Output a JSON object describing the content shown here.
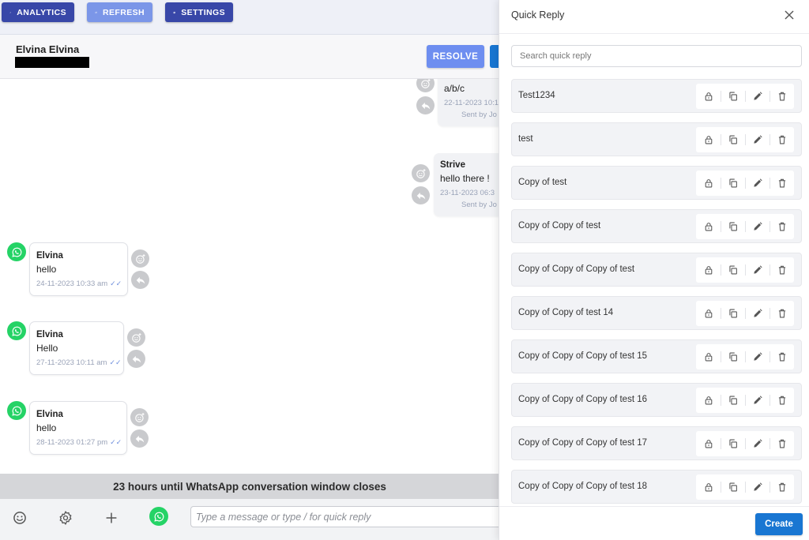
{
  "toolbar": {
    "analytics_label": "ANALYTICS",
    "refresh_label": "REFRESH",
    "settings_label": "SETTINGS"
  },
  "chat_header": {
    "contact_name": "Elvina Elvina",
    "resolve_label": "RESOLVE"
  },
  "messages": [
    {
      "direction": "out",
      "sender": "",
      "text": "a/b/c",
      "time": "22-11-2023 10:1",
      "sent_by": "Sent by Jo"
    },
    {
      "direction": "out",
      "sender": "Strive",
      "text": "hello there !",
      "time": "23-11-2023 06:3",
      "sent_by": "Sent by Jo"
    },
    {
      "direction": "in",
      "sender": "Elvina",
      "text": "hello",
      "time": "24-11-2023 10:33 am"
    },
    {
      "direction": "in",
      "sender": "Elvina",
      "text": "Hello",
      "time": "27-11-2023 10:11 am"
    },
    {
      "direction": "in",
      "sender": "Elvina",
      "text": "hello",
      "time": "28-11-2023 01:27 pm"
    }
  ],
  "window_notice": "23 hours until WhatsApp conversation window closes",
  "composer": {
    "placeholder": "Type a message or type / for quick reply"
  },
  "quick_reply": {
    "title": "Quick Reply",
    "search_placeholder": "Search quick reply",
    "items": [
      {
        "label": "Test1234"
      },
      {
        "label": "test"
      },
      {
        "label": "Copy of test"
      },
      {
        "label": "Copy of Copy of test"
      },
      {
        "label": "Copy of Copy of Copy of test"
      },
      {
        "label": "Copy of Copy of test 14"
      },
      {
        "label": "Copy of Copy of Copy of test 15"
      },
      {
        "label": "Copy of Copy of Copy of test 16"
      },
      {
        "label": "Copy of Copy of Copy of test 17"
      },
      {
        "label": "Copy of Copy of Copy of test 18"
      }
    ],
    "create_label": "Create"
  },
  "colors": {
    "primary": "#1976d2",
    "toolbar_button": "#3847a8",
    "refresh_button": "#7b96e8",
    "resolve_button": "#6e8ef0",
    "whatsapp": "#25d366"
  }
}
